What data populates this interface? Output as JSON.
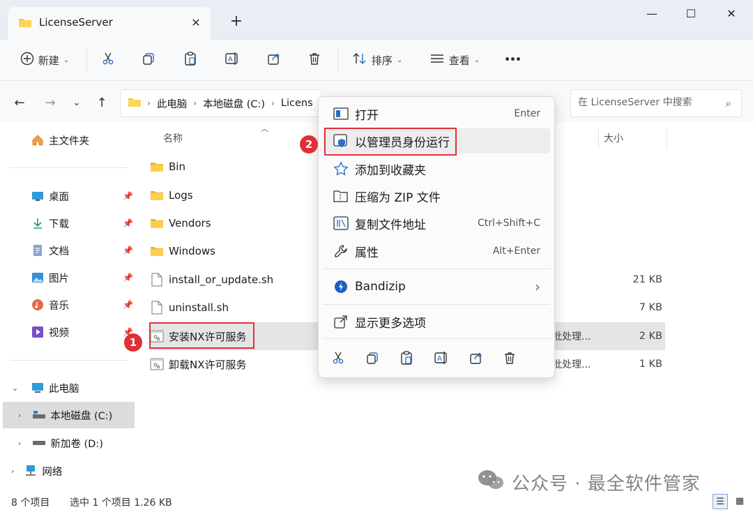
{
  "window": {
    "tab_title": "LicenseServer",
    "tab_close": "✕",
    "new_tab": "+",
    "minimize": "—",
    "maximize": "☐",
    "close": "✕"
  },
  "toolbar": {
    "new_label": "新建",
    "sort_label": "排序",
    "view_label": "查看",
    "more": "•••"
  },
  "address": {
    "crumbs": [
      "此电脑",
      "本地磁盘 (C:)",
      "LicenseServer"
    ],
    "visible_tail": "Licens"
  },
  "search": {
    "placeholder": "在 LicenseServer 中搜索"
  },
  "sidebar": {
    "home": "主文件夹",
    "quick": [
      {
        "label": "桌面",
        "icon": "desktop-icon"
      },
      {
        "label": "下载",
        "icon": "download-icon"
      },
      {
        "label": "文档",
        "icon": "document-icon"
      },
      {
        "label": "图片",
        "icon": "pictures-icon"
      },
      {
        "label": "音乐",
        "icon": "music-icon"
      },
      {
        "label": "视频",
        "icon": "video-icon"
      }
    ],
    "this_pc": "此电脑",
    "drive_c": "本地磁盘 (C:)",
    "drive_d": "新加卷 (D:)",
    "network": "网络"
  },
  "list": {
    "col_name": "名称",
    "col_size": "大小",
    "files": [
      {
        "name": "Bin",
        "type": "",
        "size": "",
        "icon": "folder-icon"
      },
      {
        "name": "Logs",
        "type": "",
        "size": "",
        "icon": "folder-icon"
      },
      {
        "name": "Vendors",
        "type": "",
        "size": "",
        "icon": "folder-icon"
      },
      {
        "name": "Windows",
        "type": "",
        "size": "",
        "icon": "folder-icon"
      },
      {
        "name": "install_or_update.sh",
        "type": "",
        "size": "21 KB",
        "icon": "file-icon"
      },
      {
        "name": "uninstall.sh",
        "type": "",
        "size": "7 KB",
        "icon": "file-icon"
      },
      {
        "name": "安装NX许可服务",
        "type": "批处理...",
        "size": "2 KB",
        "icon": "batch-file-icon"
      },
      {
        "name": "卸载NX许可服务",
        "type": "批处理...",
        "size": "1 KB",
        "icon": "batch-file-icon"
      }
    ]
  },
  "context_menu": {
    "items": [
      {
        "label": "打开",
        "key": "Enter",
        "icon": "open-icon"
      },
      {
        "label": "以管理员身份运行",
        "key": "",
        "icon": "admin-shield-icon"
      },
      {
        "label": "添加到收藏夹",
        "key": "",
        "icon": "star-icon"
      },
      {
        "label": "压缩为 ZIP 文件",
        "key": "",
        "icon": "zip-icon"
      },
      {
        "label": "复制文件地址",
        "key": "Ctrl+Shift+C",
        "icon": "copy-path-icon"
      },
      {
        "label": "属性",
        "key": "Alt+Enter",
        "icon": "wrench-icon"
      },
      {
        "label": "Bandizip",
        "key": "",
        "icon": "bandizip-icon"
      },
      {
        "label": "显示更多选项",
        "key": "",
        "icon": "more-options-icon"
      }
    ],
    "submenu_arrow": "›"
  },
  "annotations": {
    "badge1": "1",
    "badge2": "2"
  },
  "status": {
    "count": "8 个项目",
    "selected": "选中 1 个项目  1.26 KB"
  },
  "watermark": "公众号 · 最全软件管家",
  "colors": {
    "accent": "#0067c0",
    "annotation_red": "#e0303a",
    "folder": "#f0c24b"
  }
}
